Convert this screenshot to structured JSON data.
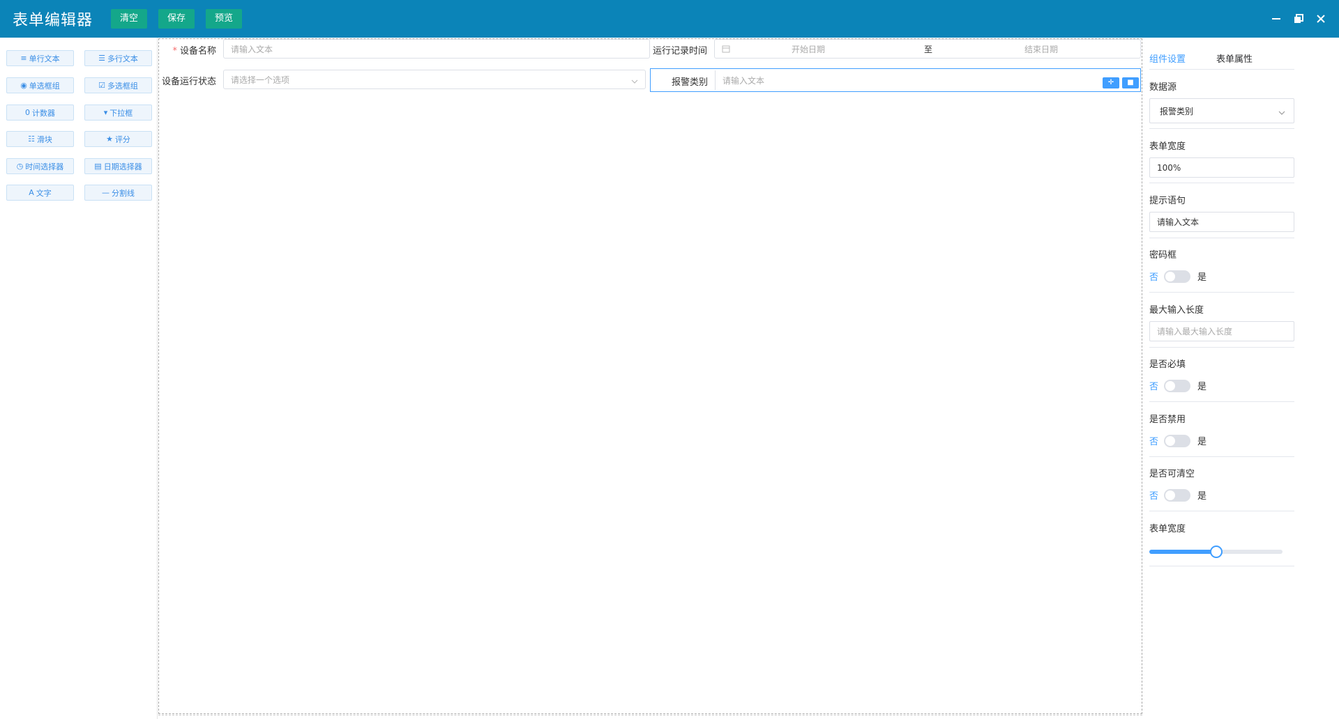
{
  "header": {
    "title": "表单编辑器",
    "buttons": {
      "clear": "清空",
      "save": "保存",
      "preview": "预览"
    }
  },
  "palette": {
    "items": [
      {
        "icon": "≡",
        "label": "单行文本"
      },
      {
        "icon": "☰",
        "label": "多行文本"
      },
      {
        "icon": "◉",
        "label": "单选框组"
      },
      {
        "icon": "☑",
        "label": "多选框组"
      },
      {
        "icon": "0",
        "label": "计数器"
      },
      {
        "icon": "▾",
        "label": "下拉框"
      },
      {
        "icon": "☷",
        "label": "滑块"
      },
      {
        "icon": "★",
        "label": "评分"
      },
      {
        "icon": "◷",
        "label": "时间选择器"
      },
      {
        "icon": "▤",
        "label": "日期选择器"
      },
      {
        "icon": "A",
        "label": "文字"
      },
      {
        "icon": "—",
        "label": "分割线"
      }
    ]
  },
  "canvas": {
    "device_name": {
      "label": "设备名称",
      "required_mark": "*",
      "placeholder": "请输入文本"
    },
    "run_time": {
      "label": "运行记录时间",
      "start_placeholder": "开始日期",
      "separator": "至",
      "end_placeholder": "结束日期"
    },
    "run_status": {
      "label": "设备运行状态",
      "placeholder": "请选择一个选项"
    },
    "alarm_type": {
      "label": "报警类别",
      "placeholder": "请输入文本",
      "tool_move": "✛",
      "tool_delete": "■"
    }
  },
  "panel": {
    "tabs": {
      "component": "组件设置",
      "form": "表单属性"
    },
    "data_source": {
      "label": "数据源",
      "value": "报警类别"
    },
    "form_width": {
      "label": "表单宽度",
      "value": "100%"
    },
    "hint": {
      "label": "提示语句",
      "value": "请输入文本"
    },
    "password": {
      "label": "密码框",
      "off": "否",
      "on": "是"
    },
    "max_length": {
      "label": "最大输入长度",
      "placeholder": "请输入最大输入长度"
    },
    "required": {
      "label": "是否必填",
      "off": "否",
      "on": "是"
    },
    "disabled": {
      "label": "是否禁用",
      "off": "否",
      "on": "是"
    },
    "clearable": {
      "label": "是否可清空",
      "off": "否",
      "on": "是"
    },
    "width_slider": {
      "label": "表单宽度",
      "value_fraction": 0.5
    }
  }
}
